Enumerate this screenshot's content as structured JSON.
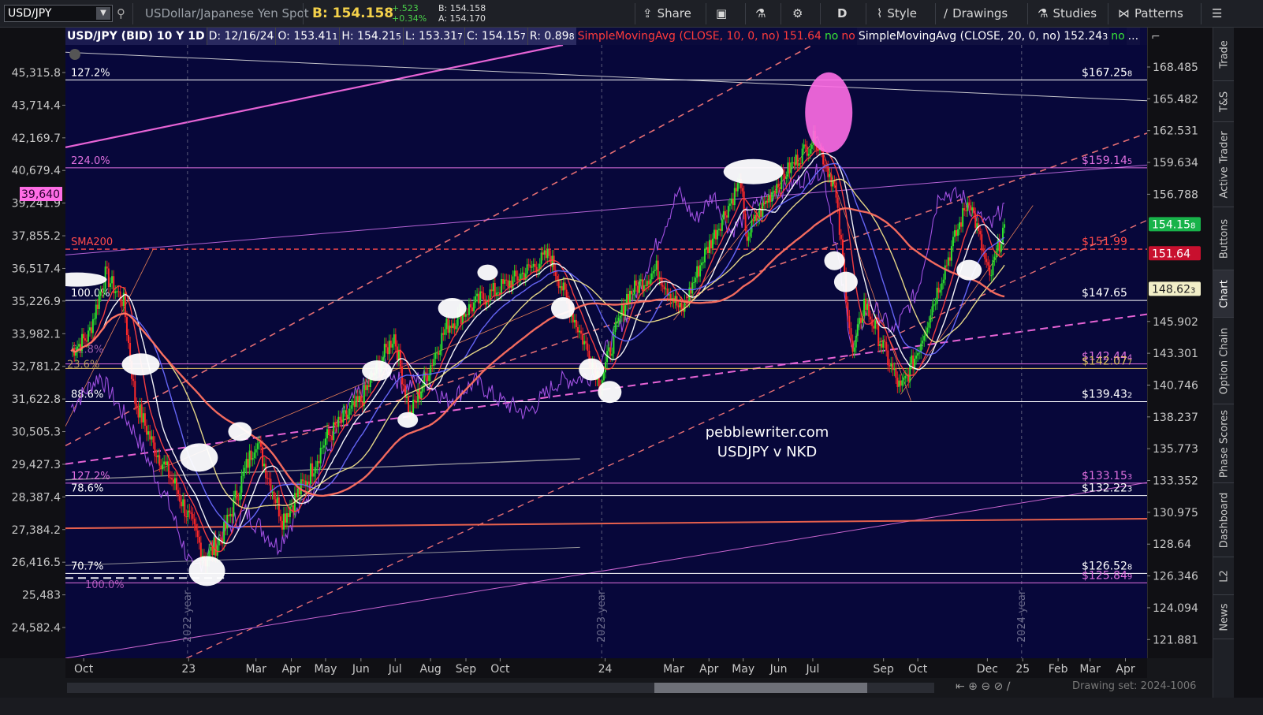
{
  "toolbar": {
    "symbol": "USD/JPY",
    "description": "USDollar/Japanese Yen Spot",
    "bid_label": "B: 154.158",
    "change": "+.523",
    "change_pct": "+0.34%",
    "bid_small": "B: 154.158",
    "ask_small": "A: 154.170",
    "share_label": "Share",
    "period_label": "D",
    "style_label": "Style",
    "drawings_label": "Drawings",
    "studies_label": "Studies",
    "patterns_label": "Patterns"
  },
  "header": {
    "title": "USD/JPY (BID) 10 Y 1D",
    "date": "D: 12/16/24",
    "open": "O: 153.41",
    "open_tail": "1",
    "high": "H: 154.21",
    "high_tail": "5",
    "low": "L: 153.31",
    "low_tail": "7",
    "close": "C: 154.15",
    "close_tail": "7",
    "range": "R: 0.89",
    "range_tail": "8",
    "study1": "SimpleMovingAvg (CLOSE, 10, 0, no)",
    "study1_value": "151.64",
    "study1_flag1": "no",
    "study1_flag2": "no",
    "study2": "SimpleMovingAvg (CLOSE, 20, 0, no)",
    "study2_value": "152.24",
    "study2_tail": "3",
    "study2_flag": "no",
    "more": "..."
  },
  "side_tabs": [
    "Trade",
    "T&S",
    "Active Trader",
    "Buttons",
    "Chart",
    "Option Chain",
    "Phase Scores",
    "Dashboard",
    "L2",
    "News"
  ],
  "bottom": {
    "drawing_set": "Drawing set: 2024-1006"
  },
  "chart_data": {
    "type": "line",
    "title": "pebblewriter.com",
    "subtitle": "USDJPY v NKD",
    "right_axis": {
      "ylim": [
        120.6,
        170.6
      ],
      "ticks": [
        "168.485",
        "165.482",
        "162.531",
        "159.634",
        "156.788",
        "154.15",
        "151.64",
        "148.62",
        "145.902",
        "143.301",
        "140.746",
        "138.237",
        "135.773",
        "133.352",
        "130.975",
        "128.64",
        "126.346",
        "124.094",
        "121.881"
      ],
      "tick_values": [
        168.485,
        165.482,
        162.531,
        159.634,
        156.788,
        154.158,
        151.64,
        148.623,
        145.902,
        143.301,
        140.746,
        138.237,
        135.773,
        133.352,
        130.975,
        128.64,
        126.346,
        124.094,
        121.881
      ],
      "badge_tails": [
        "",
        "",
        "",
        "",
        "",
        "8",
        "",
        "3",
        "",
        "",
        "",
        "",
        "",
        "",
        "",
        "",
        "",
        "",
        ""
      ]
    },
    "left_axis": {
      "ticks": [
        "45,315.8",
        "43,714.4",
        "42,169.7",
        "40,679.4",
        "39,241.9",
        "37,855.2",
        "36,517.4",
        "35,226.9",
        "33,982.1",
        "32,781.2",
        "31,622.8",
        "30,505.3",
        "29,427.3",
        "28,387.4",
        "27,384.2",
        "26,416.5",
        "25,483",
        "24,582.4"
      ],
      "tick_values": [
        45315.8,
        43714.4,
        42169.7,
        40679.4,
        39241.9,
        37855.2,
        36517.4,
        35226.9,
        33982.1,
        32781.2,
        31622.8,
        30505.3,
        29427.3,
        28387.4,
        27384.2,
        26416.5,
        25483,
        24582.4
      ],
      "badge": "39,640",
      "badge_value": 39640
    },
    "x_axis": {
      "ticks": [
        "Oct",
        "23",
        "Mar",
        "Apr",
        "May",
        "Jun",
        "Jul",
        "Aug",
        "Sep",
        "Oct",
        "24",
        "Mar",
        "Apr",
        "May",
        "Jun",
        "Jul",
        "Sep",
        "Oct",
        "Dec",
        "25",
        "Feb",
        "Mar",
        "Apr"
      ],
      "tick_dates": [
        "2022-10-01",
        "2023-01-01",
        "2023-03-01",
        "2023-04-01",
        "2023-05-01",
        "2023-06-01",
        "2023-07-01",
        "2023-08-01",
        "2023-09-01",
        "2023-10-01",
        "2024-01-01",
        "2024-03-01",
        "2024-04-01",
        "2024-05-01",
        "2024-06-01",
        "2024-07-01",
        "2024-09-01",
        "2024-10-01",
        "2024-12-01",
        "2025-01-01",
        "2025-02-01",
        "2025-03-01",
        "2025-04-01"
      ],
      "xlim": [
        "2022-09-15",
        "2025-04-20"
      ],
      "year_markers": [
        {
          "label": "2022 year",
          "date": "2022-12-31"
        },
        {
          "label": "2023 year",
          "date": "2023-12-29"
        },
        {
          "label": "2024 year",
          "date": "2024-12-31"
        }
      ]
    },
    "levels": [
      {
        "left_label": "127.2%",
        "right_label": "$167.25",
        "right_tail": "8",
        "value": 167.258,
        "color": "#ffffff"
      },
      {
        "left_label": "224.0%",
        "right_label": "$159.14",
        "right_tail": "5",
        "value": 159.145,
        "color": "#e070e0"
      },
      {
        "left_label": "SMA200",
        "right_label": "$151.99",
        "right_tail": "",
        "value": 151.99,
        "color": "#ff4a4a",
        "dashed": true
      },
      {
        "left_label": "100.0%",
        "right_label": "$147.65",
        "right_tail": "",
        "value": 147.65,
        "color": "#ffffff"
      },
      {
        "left_label": "",
        "right_label": "$142.44",
        "right_tail": "4",
        "value": 142.444,
        "color": "#e070e0"
      },
      {
        "left_label": "",
        "right_label": "$142.07",
        "right_tail": "7",
        "value": 142.077,
        "color": "#e0c060"
      },
      {
        "left_label": "88.6%",
        "right_label": "$139.43",
        "right_tail": "2",
        "value": 139.432,
        "color": "#ffffff"
      },
      {
        "left_label": "127.2%",
        "right_label": "$133.15",
        "right_tail": "3",
        "value": 133.153,
        "color": "#e070e0"
      },
      {
        "left_label": "78.6%",
        "right_label": "$132.22",
        "right_tail": "3",
        "value": 132.223,
        "color": "#ffffff"
      },
      {
        "left_label": "70.7%",
        "right_label": "$126.52",
        "right_tail": "8",
        "value": 126.528,
        "color": "#ffffff"
      },
      {
        "left_label": "",
        "right_label": "$125.84",
        "right_tail": "9",
        "value": 125.849,
        "color": "#e070e0"
      }
    ],
    "fib_fragments": [
      "61.8%",
      "23.6%",
      "100.0%"
    ],
    "price_path": [
      [
        "2022-09-20",
        143.5
      ],
      [
        "2022-10-05",
        144.7
      ],
      [
        "2022-10-20",
        149.8
      ],
      [
        "2022-11-05",
        147.5
      ],
      [
        "2022-11-15",
        139.5
      ],
      [
        "2022-12-01",
        136.0
      ],
      [
        "2022-12-20",
        133.0
      ],
      [
        "2023-01-16",
        127.5
      ],
      [
        "2023-02-01",
        129.5
      ],
      [
        "2023-03-01",
        136.5
      ],
      [
        "2023-03-24",
        130.5
      ],
      [
        "2023-04-15",
        133.5
      ],
      [
        "2023-05-01",
        136.5
      ],
      [
        "2023-06-01",
        139.5
      ],
      [
        "2023-06-30",
        144.8
      ],
      [
        "2023-07-14",
        138.3
      ],
      [
        "2023-08-15",
        145.5
      ],
      [
        "2023-09-15",
        147.8
      ],
      [
        "2023-10-15",
        149.5
      ],
      [
        "2023-11-13",
        151.5
      ],
      [
        "2023-12-01",
        147.0
      ],
      [
        "2023-12-28",
        141.0
      ],
      [
        "2024-01-20",
        148.0
      ],
      [
        "2024-02-15",
        150.3
      ],
      [
        "2024-03-08",
        146.6
      ],
      [
        "2024-03-27",
        151.3
      ],
      [
        "2024-04-29",
        158.0
      ],
      [
        "2024-05-03",
        152.9
      ],
      [
        "2024-05-29",
        157.5
      ],
      [
        "2024-07-03",
        161.9
      ],
      [
        "2024-07-20",
        157.5
      ],
      [
        "2024-08-05",
        143.0
      ],
      [
        "2024-08-15",
        147.5
      ],
      [
        "2024-09-16",
        140.3
      ],
      [
        "2024-10-01",
        143.5
      ],
      [
        "2024-11-01",
        152.5
      ],
      [
        "2024-11-15",
        156.5
      ],
      [
        "2024-12-03",
        149.4
      ],
      [
        "2024-12-16",
        154.158
      ]
    ],
    "overlay_path": [
      [
        "2022-09-20",
        139.0
      ],
      [
        "2022-10-15",
        141.5
      ],
      [
        "2022-11-15",
        137.0
      ],
      [
        "2022-12-15",
        131.5
      ],
      [
        "2023-01-05",
        126.5
      ],
      [
        "2023-01-25",
        129.0
      ],
      [
        "2023-02-20",
        131.0
      ],
      [
        "2023-03-20",
        128.5
      ],
      [
        "2023-04-20",
        133.0
      ],
      [
        "2023-05-20",
        139.0
      ],
      [
        "2023-06-20",
        142.5
      ],
      [
        "2023-07-10",
        140.5
      ],
      [
        "2023-07-25",
        141.5
      ],
      [
        "2023-08-15",
        139.5
      ],
      [
        "2023-09-10",
        141.0
      ],
      [
        "2023-10-01",
        139.5
      ],
      [
        "2023-10-25",
        138.5
      ],
      [
        "2023-11-20",
        141.0
      ],
      [
        "2023-12-20",
        141.5
      ],
      [
        "2024-01-20",
        146.5
      ],
      [
        "2024-02-20",
        153.5
      ],
      [
        "2024-03-05",
        157.0
      ],
      [
        "2024-03-20",
        154.5
      ],
      [
        "2024-04-05",
        156.8
      ],
      [
        "2024-04-20",
        153.5
      ],
      [
        "2024-05-20",
        156.5
      ],
      [
        "2024-06-20",
        158.0
      ],
      [
        "2024-07-10",
        159.0
      ],
      [
        "2024-08-05",
        143.5
      ],
      [
        "2024-08-20",
        147.5
      ],
      [
        "2024-09-10",
        145.0
      ],
      [
        "2024-10-01",
        148.5
      ],
      [
        "2024-10-20",
        157.0
      ],
      [
        "2024-11-10",
        156.5
      ],
      [
        "2024-11-20",
        155.0
      ],
      [
        "2024-12-05",
        154.0
      ],
      [
        "2024-12-16",
        156.0
      ]
    ],
    "sma_series": [
      {
        "name": "SimpleMovingAvg (CLOSE, 10, 0, no)",
        "color": "#ff4040",
        "window": 3
      },
      {
        "name": "SimpleMovingAvg (CLOSE, 20, 0, no)",
        "color": "#ffffff",
        "window": 5
      },
      {
        "name": "",
        "color": "#6a6aff",
        "window": 9
      },
      {
        "name": "",
        "color": "#f0e08a",
        "window": 14
      },
      {
        "name": "",
        "color": "#ff7060",
        "window": 26
      }
    ],
    "highlights": [
      {
        "date": "2022-09-25",
        "value": 149.4,
        "rx": 38,
        "ry": 9,
        "color": "#ffffff"
      },
      {
        "date": "2022-11-20",
        "value": 142.4,
        "rx": 24,
        "ry": 14,
        "color": "#ffffff"
      },
      {
        "date": "2023-01-10",
        "value": 135.1,
        "rx": 24,
        "ry": 18,
        "color": "#ffffff"
      },
      {
        "date": "2023-02-15",
        "value": 137.1,
        "rx": 15,
        "ry": 12,
        "color": "#ffffff"
      },
      {
        "date": "2023-01-17",
        "value": 126.7,
        "rx": 23,
        "ry": 19,
        "color": "#ffffff"
      },
      {
        "date": "2023-06-15",
        "value": 141.9,
        "rx": 19,
        "ry": 13,
        "color": "#ffffff"
      },
      {
        "date": "2023-07-12",
        "value": 138.0,
        "rx": 13,
        "ry": 10,
        "color": "#ffffff"
      },
      {
        "date": "2023-08-20",
        "value": 147.0,
        "rx": 18,
        "ry": 13,
        "color": "#ffffff"
      },
      {
        "date": "2023-09-20",
        "value": 150.0,
        "rx": 13,
        "ry": 10,
        "color": "#ffffff"
      },
      {
        "date": "2023-11-25",
        "value": 147.0,
        "rx": 15,
        "ry": 14,
        "color": "#ffffff"
      },
      {
        "date": "2023-12-20",
        "value": 142.0,
        "rx": 16,
        "ry": 14,
        "color": "#ffffff"
      },
      {
        "date": "2024-01-05",
        "value": 140.2,
        "rx": 15,
        "ry": 14,
        "color": "#ffffff"
      },
      {
        "date": "2024-05-10",
        "value": 158.8,
        "rx": 38,
        "ry": 16,
        "color": "#ffffff"
      },
      {
        "date": "2024-07-20",
        "value": 151.0,
        "rx": 13,
        "ry": 12,
        "color": "#ffffff"
      },
      {
        "date": "2024-07-30",
        "value": 149.2,
        "rx": 15,
        "ry": 13,
        "color": "#ffffff"
      },
      {
        "date": "2024-11-15",
        "value": 150.2,
        "rx": 16,
        "ry": 13,
        "color": "#ffffff"
      },
      {
        "date": "2024-07-15",
        "value": 164.2,
        "rx": 30,
        "ry": 51,
        "color": "#ff6ee6"
      }
    ],
    "grid": false,
    "legend": "top-left"
  }
}
